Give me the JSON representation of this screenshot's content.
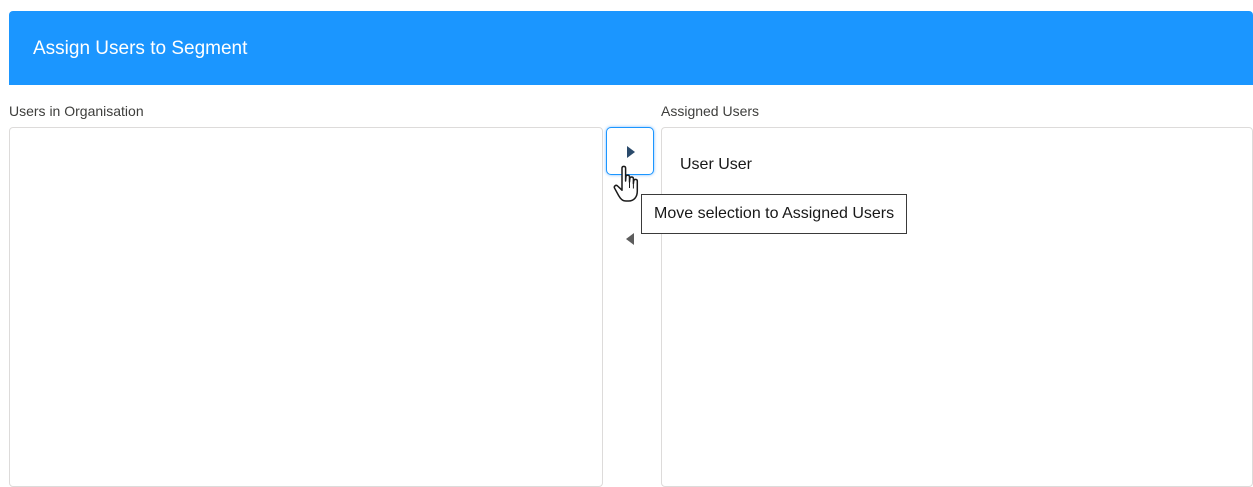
{
  "header": {
    "title": "Assign Users to Segment",
    "color": "#1b96ff"
  },
  "available": {
    "label": "Users in Organisation",
    "items": []
  },
  "assigned": {
    "label": "Assigned Users",
    "items": [
      "User User"
    ]
  },
  "controls": {
    "move_right_icon": "caret-right-icon",
    "move_left_icon": "caret-left-icon",
    "tooltip": "Move selection to Assigned Users"
  }
}
